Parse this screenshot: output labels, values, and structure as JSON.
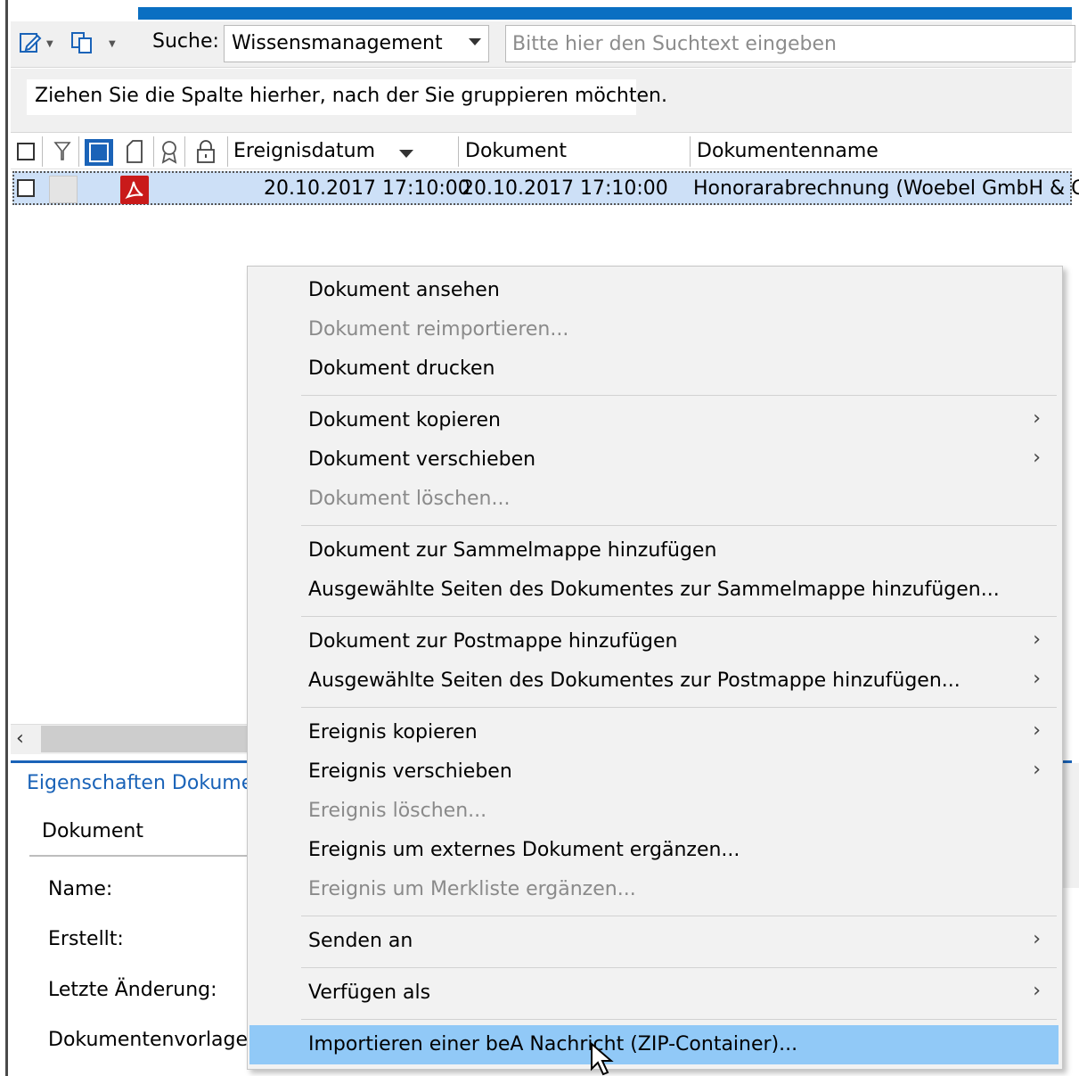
{
  "toolbar": {
    "search_label": "Suche:",
    "search_scope": "Wissensmanagement",
    "search_placeholder": "Bitte hier den Suchtext eingeben"
  },
  "grid": {
    "group_hint": "Ziehen Sie die Spalte hierher, nach der Sie gruppieren möchten.",
    "columns": [
      "Ereignisdatum",
      "Dokument",
      "Dokumentenname"
    ],
    "rows": [
      {
        "ereignisdatum": "20.10.2017 17:10:00",
        "dokument": "20.10.2017 17:10:00",
        "dokumentenname": "Honorarabrechnung (Woebel GmbH & C"
      }
    ]
  },
  "properties": {
    "title": "Eigenschaften Dokume",
    "tab": "Dokument",
    "labels": [
      "Name:",
      "Erstellt:",
      "Letzte Änderung:",
      "Dokumentenvorlage:"
    ]
  },
  "context_menu": {
    "items": [
      {
        "label": "Dokument ansehen",
        "enabled": true,
        "submenu": false
      },
      {
        "label": "Dokument reimportieren...",
        "enabled": false,
        "submenu": false
      },
      {
        "label": "Dokument drucken",
        "enabled": true,
        "submenu": false
      },
      {
        "label": "Dokument kopieren",
        "enabled": true,
        "submenu": true
      },
      {
        "label": "Dokument verschieben",
        "enabled": true,
        "submenu": true
      },
      {
        "label": "Dokument löschen...",
        "enabled": false,
        "submenu": false
      },
      {
        "label": "Dokument zur Sammelmappe hinzufügen",
        "enabled": true,
        "submenu": false
      },
      {
        "label": "Ausgewählte Seiten des Dokumentes zur Sammelmappe hinzufügen...",
        "enabled": true,
        "submenu": false
      },
      {
        "label": "Dokument zur Postmappe hinzufügen",
        "enabled": true,
        "submenu": true
      },
      {
        "label": "Ausgewählte Seiten des Dokumentes zur Postmappe hinzufügen...",
        "enabled": true,
        "submenu": true
      },
      {
        "label": "Ereignis kopieren",
        "enabled": true,
        "submenu": true
      },
      {
        "label": "Ereignis verschieben",
        "enabled": true,
        "submenu": true
      },
      {
        "label": "Ereignis löschen...",
        "enabled": false,
        "submenu": false
      },
      {
        "label": "Ereignis um externes Dokument ergänzen...",
        "enabled": true,
        "submenu": false
      },
      {
        "label": "Ereignis um Merkliste ergänzen...",
        "enabled": false,
        "submenu": false
      },
      {
        "label": "Senden an",
        "enabled": true,
        "submenu": true
      },
      {
        "label": "Verfügen als",
        "enabled": true,
        "submenu": true
      },
      {
        "label": "Importieren einer beA Nachricht (ZIP-Container)...",
        "enabled": true,
        "submenu": false,
        "highlighted": true
      }
    ]
  },
  "colors": {
    "accent_blue": "#0a6fc2",
    "highlight": "#91c9f7",
    "selected_row": "#cde0f7",
    "pdf_red": "#c91a1a"
  }
}
